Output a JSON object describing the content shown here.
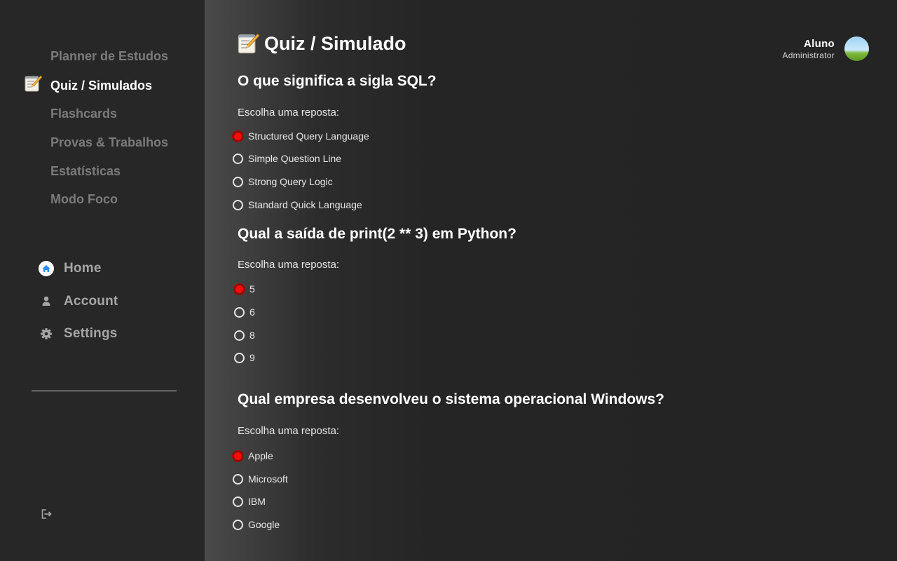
{
  "sidebar": {
    "items": [
      {
        "label": "Planner de Estudos",
        "active": false
      },
      {
        "label": "Quiz / Simulados",
        "active": true,
        "icon": "memo-icon"
      },
      {
        "label": "Flashcards",
        "active": false
      },
      {
        "label": "Provas & Trabalhos",
        "active": false
      },
      {
        "label": "Estatísticas",
        "active": false
      },
      {
        "label": "Modo Foco",
        "active": false
      }
    ],
    "bottom": [
      {
        "label": "Home",
        "icon": "home-icon"
      },
      {
        "label": "Account",
        "icon": "user-icon"
      },
      {
        "label": "Settings",
        "icon": "gear-icon"
      }
    ],
    "logout_icon": "logout-icon"
  },
  "header": {
    "title": "Quiz / Simulado",
    "title_icon": "memo-icon",
    "user": {
      "name": "Aluno",
      "role": "Administrator"
    }
  },
  "quiz": {
    "prompt": "Escolha uma reposta:",
    "questions": [
      {
        "text": "O que significa a sigla SQL?",
        "options": [
          "Structured Query Language",
          "Simple Question Line",
          "Strong Query Logic",
          "Standard Quick Language"
        ],
        "selected": 0
      },
      {
        "text": "Qual a saída de print(2 ** 3) em Python?",
        "options": [
          "5",
          "6",
          "8",
          "9"
        ],
        "selected": 0
      },
      {
        "text": "Qual empresa desenvolveu o sistema operacional Windows?",
        "options": [
          "Apple",
          "Microsoft",
          "IBM",
          "Google"
        ],
        "selected": 0
      }
    ]
  },
  "colors": {
    "sidebar_bg": "#272727",
    "main_bg": "#242424",
    "selected_radio": "#ff0a0a",
    "inactive_nav": "#7b7b7b",
    "home_icon_accent": "#2f8df0"
  }
}
